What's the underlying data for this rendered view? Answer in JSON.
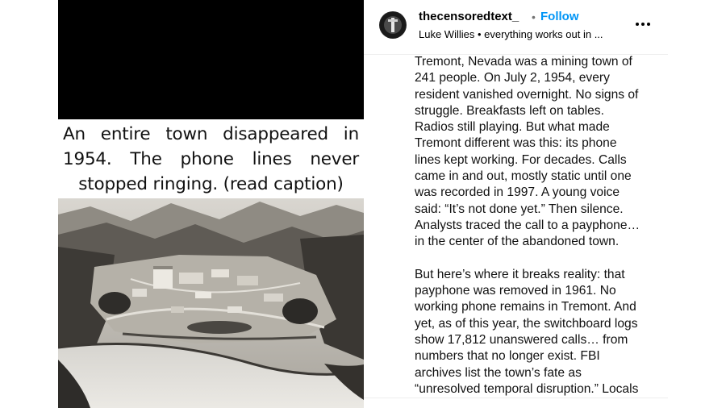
{
  "media": {
    "caption_text": "An entire town disappeared in 1954. The phone lines never stopped ringing. (read caption)"
  },
  "post": {
    "username": "thecensoredtext_",
    "separator": "•",
    "follow_label": "Follow",
    "subline": "Luke Willies • everything works out in ...",
    "caption_paragraphs": [
      "Tremont, Nevada was a mining town of\n241 people. On July 2, 1954, every\nresident vanished overnight. No signs of\nstruggle. Breakfasts left on tables.\nRadios still playing. But what made\nTremont different was this: its phone\nlines kept working. For decades. Calls\ncame in and out, mostly static until one\nwas recorded in 1997. A young voice\nsaid: “It’s not done yet.” Then silence.\nAnalysts traced the call to a payphone…\nin the center of the abandoned town.",
      "But here’s where it breaks reality: that\npayphone was removed in 1961. No\nworking phone remains in Tremont. And\nyet, as of this year, the switchboard logs\nshow 17,812 unanswered calls… from\nnumbers that no longer exist. FBI\narchives list the town’s fate as\n“unresolved temporal disruption.” Locals"
    ]
  },
  "icons": {
    "avatar": "avatar-image",
    "more": "more-options-icon"
  },
  "colors": {
    "follow": "#0095f6",
    "photo_tone": "sepia-grayscale"
  }
}
